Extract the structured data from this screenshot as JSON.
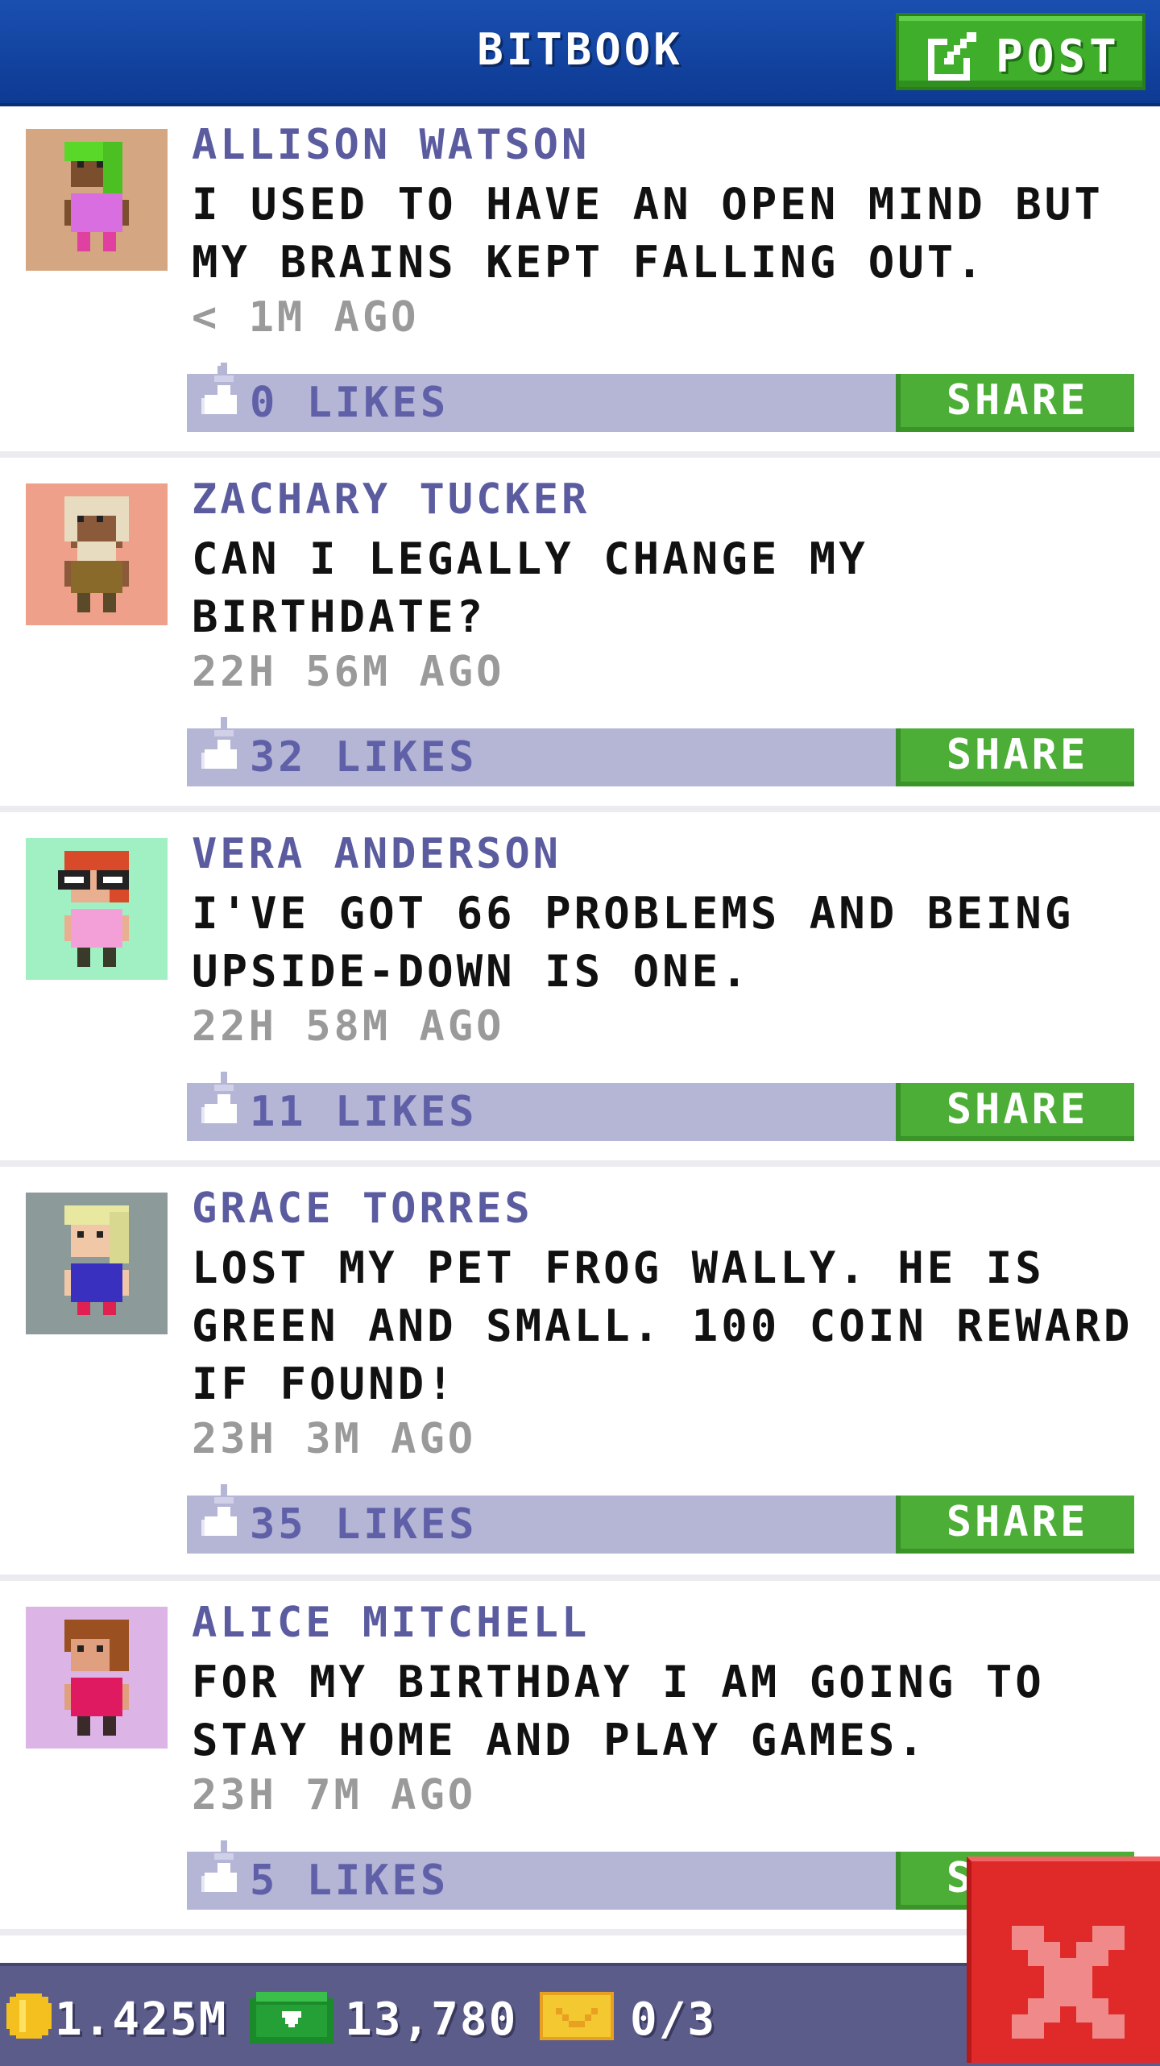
{
  "header": {
    "title": "BITBOOK",
    "post_button_label": "POST",
    "post_icon": "edit-icon"
  },
  "posts": [
    {
      "author": "ALLISON WATSON",
      "text": "I USED TO HAVE AN OPEN MIND BUT MY BRAINS KEPT FALLING OUT.",
      "time": "< 1M AGO",
      "likes": "0 LIKES",
      "share": "SHARE",
      "avatar_bg": "#d4a682"
    },
    {
      "author": "ZACHARY TUCKER",
      "text": "CAN I LEGALLY CHANGE MY BIRTHDATE?",
      "time": "22H 56M AGO",
      "likes": "32 LIKES",
      "share": "SHARE",
      "avatar_bg": "#efa08a"
    },
    {
      "author": "VERA ANDERSON",
      "text": "I'VE GOT 66 PROBLEMS AND BEING UPSIDE-DOWN IS ONE.",
      "time": "22H 58M AGO",
      "likes": "11 LIKES",
      "share": "SHARE",
      "avatar_bg": "#a0f0c4"
    },
    {
      "author": "GRACE TORRES",
      "text": "LOST MY PET FROG WALLY. HE IS GREEN AND SMALL. 100 COIN REWARD IF FOUND!",
      "time": "23H 3M AGO",
      "likes": "35 LIKES",
      "share": "SHARE",
      "avatar_bg": "#8c9a9a"
    },
    {
      "author": "ALICE MITCHELL",
      "text": "FOR MY BIRTHDAY I AM GOING TO STAY HOME AND PLAY GAMES.",
      "time": "23H 7M AGO",
      "likes": "5 LIKES",
      "share": "SHARE",
      "avatar_bg": "#dcb4e6"
    }
  ],
  "status_bar": {
    "coins": "1.425M",
    "bux": "13,780",
    "tickets": "0/3",
    "coin_icon": "coin-icon",
    "bux_icon": "bux-icon",
    "ticket_icon": "ticket-icon"
  },
  "close_icon": "close-icon",
  "colors": {
    "header_blue": "#1a4fb0",
    "share_green": "#4cae36",
    "like_bar": "#b5b5d6",
    "name_purple": "#5b5ba0",
    "close_red": "#e02a2a"
  }
}
